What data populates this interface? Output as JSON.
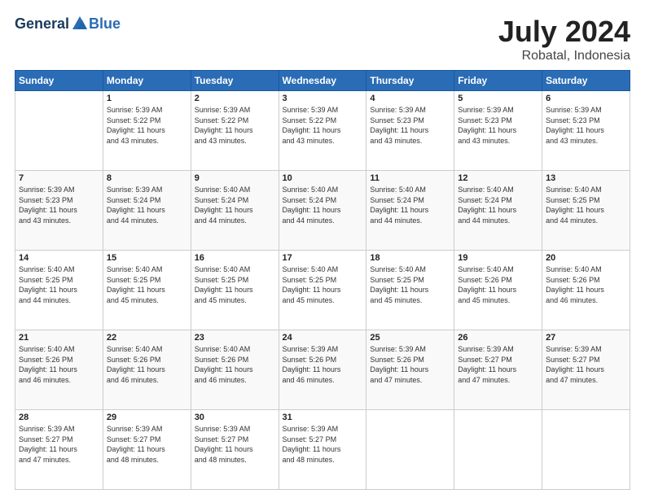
{
  "header": {
    "logo_general": "General",
    "logo_blue": "Blue",
    "month": "July 2024",
    "location": "Robatal, Indonesia"
  },
  "days_of_week": [
    "Sunday",
    "Monday",
    "Tuesday",
    "Wednesday",
    "Thursday",
    "Friday",
    "Saturday"
  ],
  "weeks": [
    [
      {
        "day": "",
        "content": ""
      },
      {
        "day": "1",
        "content": "Sunrise: 5:39 AM\nSunset: 5:22 PM\nDaylight: 11 hours\nand 43 minutes."
      },
      {
        "day": "2",
        "content": "Sunrise: 5:39 AM\nSunset: 5:22 PM\nDaylight: 11 hours\nand 43 minutes."
      },
      {
        "day": "3",
        "content": "Sunrise: 5:39 AM\nSunset: 5:22 PM\nDaylight: 11 hours\nand 43 minutes."
      },
      {
        "day": "4",
        "content": "Sunrise: 5:39 AM\nSunset: 5:23 PM\nDaylight: 11 hours\nand 43 minutes."
      },
      {
        "day": "5",
        "content": "Sunrise: 5:39 AM\nSunset: 5:23 PM\nDaylight: 11 hours\nand 43 minutes."
      },
      {
        "day": "6",
        "content": "Sunrise: 5:39 AM\nSunset: 5:23 PM\nDaylight: 11 hours\nand 43 minutes."
      }
    ],
    [
      {
        "day": "7",
        "content": "Sunrise: 5:39 AM\nSunset: 5:23 PM\nDaylight: 11 hours\nand 43 minutes."
      },
      {
        "day": "8",
        "content": "Sunrise: 5:39 AM\nSunset: 5:24 PM\nDaylight: 11 hours\nand 44 minutes."
      },
      {
        "day": "9",
        "content": "Sunrise: 5:40 AM\nSunset: 5:24 PM\nDaylight: 11 hours\nand 44 minutes."
      },
      {
        "day": "10",
        "content": "Sunrise: 5:40 AM\nSunset: 5:24 PM\nDaylight: 11 hours\nand 44 minutes."
      },
      {
        "day": "11",
        "content": "Sunrise: 5:40 AM\nSunset: 5:24 PM\nDaylight: 11 hours\nand 44 minutes."
      },
      {
        "day": "12",
        "content": "Sunrise: 5:40 AM\nSunset: 5:24 PM\nDaylight: 11 hours\nand 44 minutes."
      },
      {
        "day": "13",
        "content": "Sunrise: 5:40 AM\nSunset: 5:25 PM\nDaylight: 11 hours\nand 44 minutes."
      }
    ],
    [
      {
        "day": "14",
        "content": "Sunrise: 5:40 AM\nSunset: 5:25 PM\nDaylight: 11 hours\nand 44 minutes."
      },
      {
        "day": "15",
        "content": "Sunrise: 5:40 AM\nSunset: 5:25 PM\nDaylight: 11 hours\nand 45 minutes."
      },
      {
        "day": "16",
        "content": "Sunrise: 5:40 AM\nSunset: 5:25 PM\nDaylight: 11 hours\nand 45 minutes."
      },
      {
        "day": "17",
        "content": "Sunrise: 5:40 AM\nSunset: 5:25 PM\nDaylight: 11 hours\nand 45 minutes."
      },
      {
        "day": "18",
        "content": "Sunrise: 5:40 AM\nSunset: 5:25 PM\nDaylight: 11 hours\nand 45 minutes."
      },
      {
        "day": "19",
        "content": "Sunrise: 5:40 AM\nSunset: 5:26 PM\nDaylight: 11 hours\nand 45 minutes."
      },
      {
        "day": "20",
        "content": "Sunrise: 5:40 AM\nSunset: 5:26 PM\nDaylight: 11 hours\nand 46 minutes."
      }
    ],
    [
      {
        "day": "21",
        "content": "Sunrise: 5:40 AM\nSunset: 5:26 PM\nDaylight: 11 hours\nand 46 minutes."
      },
      {
        "day": "22",
        "content": "Sunrise: 5:40 AM\nSunset: 5:26 PM\nDaylight: 11 hours\nand 46 minutes."
      },
      {
        "day": "23",
        "content": "Sunrise: 5:40 AM\nSunset: 5:26 PM\nDaylight: 11 hours\nand 46 minutes."
      },
      {
        "day": "24",
        "content": "Sunrise: 5:39 AM\nSunset: 5:26 PM\nDaylight: 11 hours\nand 46 minutes."
      },
      {
        "day": "25",
        "content": "Sunrise: 5:39 AM\nSunset: 5:26 PM\nDaylight: 11 hours\nand 47 minutes."
      },
      {
        "day": "26",
        "content": "Sunrise: 5:39 AM\nSunset: 5:27 PM\nDaylight: 11 hours\nand 47 minutes."
      },
      {
        "day": "27",
        "content": "Sunrise: 5:39 AM\nSunset: 5:27 PM\nDaylight: 11 hours\nand 47 minutes."
      }
    ],
    [
      {
        "day": "28",
        "content": "Sunrise: 5:39 AM\nSunset: 5:27 PM\nDaylight: 11 hours\nand 47 minutes."
      },
      {
        "day": "29",
        "content": "Sunrise: 5:39 AM\nSunset: 5:27 PM\nDaylight: 11 hours\nand 48 minutes."
      },
      {
        "day": "30",
        "content": "Sunrise: 5:39 AM\nSunset: 5:27 PM\nDaylight: 11 hours\nand 48 minutes."
      },
      {
        "day": "31",
        "content": "Sunrise: 5:39 AM\nSunset: 5:27 PM\nDaylight: 11 hours\nand 48 minutes."
      },
      {
        "day": "",
        "content": ""
      },
      {
        "day": "",
        "content": ""
      },
      {
        "day": "",
        "content": ""
      }
    ]
  ]
}
